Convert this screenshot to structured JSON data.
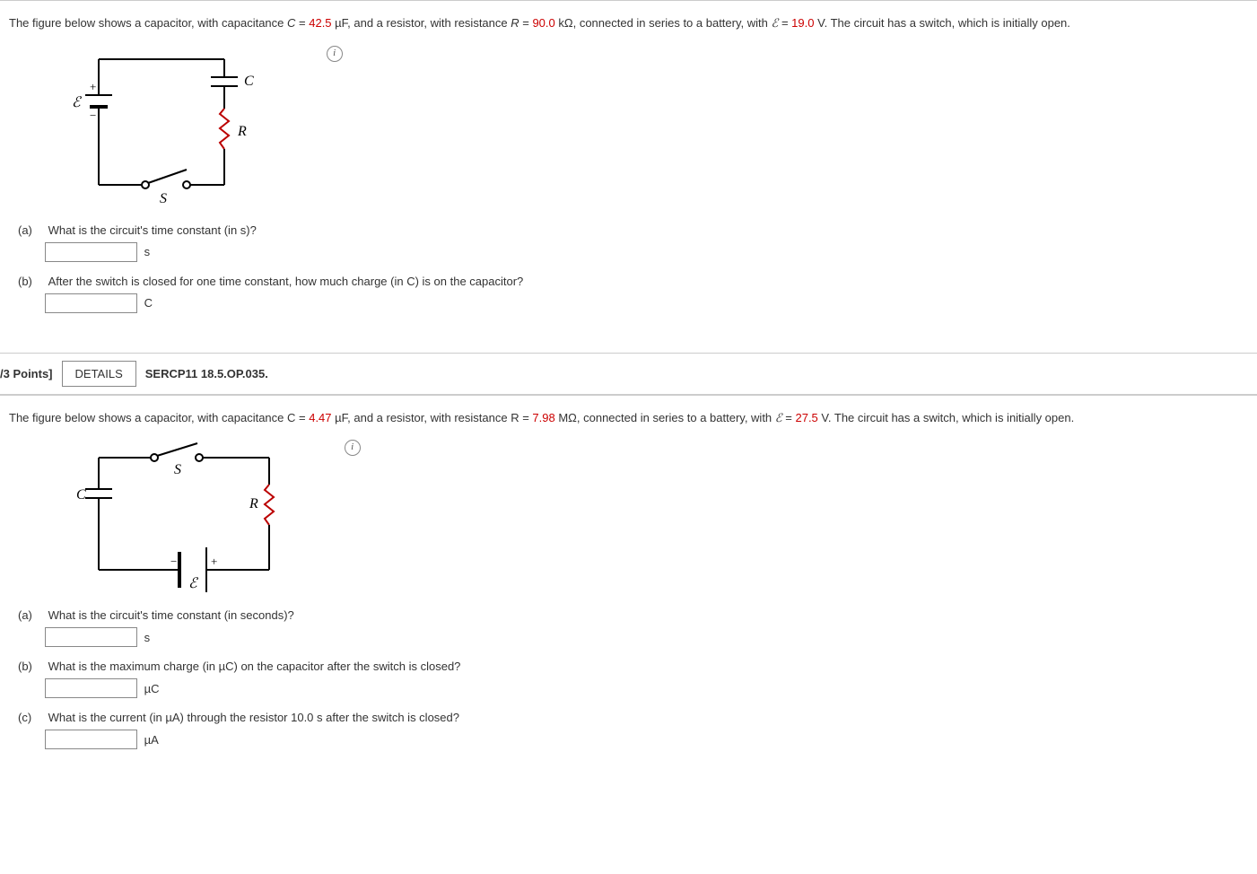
{
  "q1": {
    "intro_pre": "The figure below shows a capacitor, with capacitance ",
    "C_var": "C",
    "eq": " = ",
    "C_val": "42.5",
    "C_unit": " µF, and a resistor, with resistance ",
    "R_var": "R",
    "R_val": "90.0",
    "R_unit": " kΩ, connected in series to a battery, with ",
    "E_sym": "ℰ",
    "E_val": "19.0",
    "E_unit": " V. The circuit has a switch, which is initially open.",
    "a": {
      "label": "(a)",
      "text": "What is the circuit's time constant (in s)?",
      "unit": "s"
    },
    "b": {
      "label": "(b)",
      "text": "After the switch is closed for one time constant, how much charge (in C) is on the capacitor?",
      "unit": "C"
    },
    "info_glyph": "i"
  },
  "hdr": {
    "points": "/3 Points]",
    "details": "DETAILS",
    "source": "SERCP11 18.5.OP.035."
  },
  "q2": {
    "intro_pre": "The figure below shows a capacitor, with capacitance C = ",
    "C_val": "4.47",
    "C_unit": " µF, and a resistor, with resistance R = ",
    "R_val": "7.98",
    "R_unit": " MΩ, connected in series to a battery, with ",
    "E_sym": "ℰ",
    "eq": " = ",
    "E_val": "27.5",
    "E_unit": " V. The circuit has a switch, which is initially open.",
    "a": {
      "label": "(a)",
      "text": "What is the circuit's time constant (in seconds)?",
      "unit": "s"
    },
    "b": {
      "label": "(b)",
      "text": "What is the maximum charge (in µC) on the capacitor after the switch is closed?",
      "unit": "µC"
    },
    "c": {
      "label": "(c)",
      "text": "What is the current (in µA) through the resistor 10.0 s after the switch is closed?",
      "unit": "µA"
    },
    "info_glyph": "i"
  }
}
